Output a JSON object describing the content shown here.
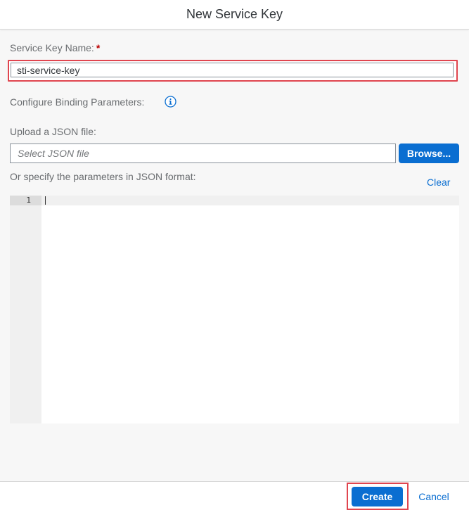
{
  "dialog": {
    "title": "New Service Key"
  },
  "form": {
    "name_label": "Service Key Name:",
    "name_required_marker": "*",
    "name_value": "sti-service-key",
    "binding_label": "Configure Binding Parameters:",
    "upload_label": "Upload a JSON file:",
    "file_placeholder": "Select JSON file",
    "browse_label": "Browse...",
    "json_label": "Or specify the parameters in JSON format:",
    "clear_label": "Clear"
  },
  "editor": {
    "line_numbers": [
      "1"
    ],
    "content": ""
  },
  "footer": {
    "create_label": "Create",
    "cancel_label": "Cancel"
  },
  "colors": {
    "accent": "#0a6ed1",
    "highlight": "#e0454f",
    "required": "#bb0000"
  },
  "icons": {
    "binding_info": "info-icon"
  }
}
